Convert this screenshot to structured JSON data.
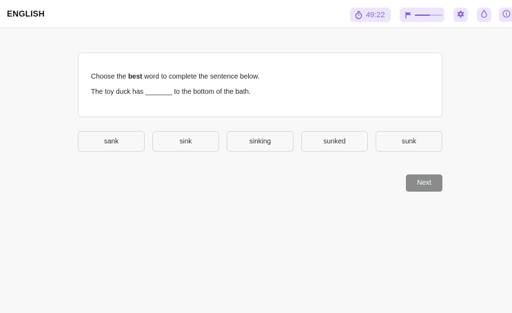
{
  "header": {
    "title": "ENGLISH",
    "timer": "49:22",
    "progress_fraction": 0.55,
    "icons": [
      "stopwatch-icon",
      "flag-icon",
      "gear-icon",
      "drop-icon",
      "info-icon"
    ]
  },
  "question": {
    "line1_prefix": "Choose the ",
    "line1_bold": "best",
    "line1_suffix": " word to complete the sentence below.",
    "line2": "The toy duck has _______ to the bottom of the bath."
  },
  "answers": [
    "sank",
    "sink",
    "sinking",
    "sunked",
    "sunk"
  ],
  "next_label": "Next",
  "colors": {
    "accent": "#8a63d8",
    "accent_bg": "#ede6fb",
    "next_button": "#8a8c8b",
    "page_bg": "#f7f8f7"
  }
}
